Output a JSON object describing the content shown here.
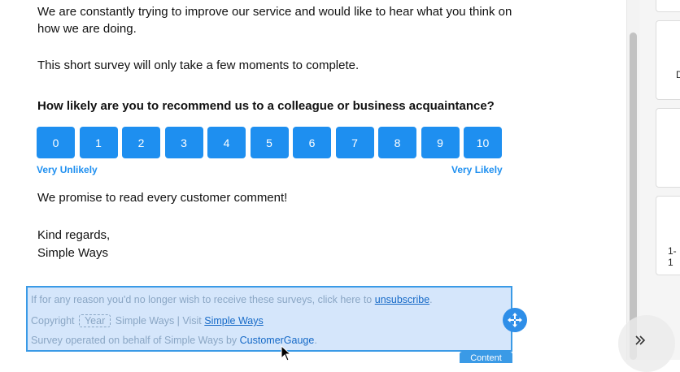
{
  "survey": {
    "intro_line1": "We are constantly trying to improve our service and would like to hear what you think on",
    "intro_line2": "how we are doing.",
    "short_survey": "This short survey will only take a few moments to complete.",
    "question": "How likely are you to recommend us to a colleague or business acquaintance?",
    "scale": [
      "0",
      "1",
      "2",
      "3",
      "4",
      "5",
      "6",
      "7",
      "8",
      "9",
      "10"
    ],
    "label_low": "Very Unlikely",
    "label_high": "Very Likely",
    "promise": "We promise to read every customer comment!",
    "closing": "Kind regards,",
    "signature": "Simple Ways"
  },
  "footer": {
    "unsubscribe_prefix": "If for any reason you'd no longer wish to receive these surveys, click here to ",
    "unsubscribe_link": "unsubscribe",
    "unsubscribe_suffix": ".",
    "copyright_prefix": "Copyright",
    "year_chip": "Year",
    "copyright_mid": "Simple Ways | Visit",
    "visit_link": "Simple Ways",
    "operated_prefix": "Survey operated on behalf of Simple Ways by ",
    "operated_link": "CustomerGauge",
    "operated_suffix": "."
  },
  "editor": {
    "content_tab": "Content",
    "move_icon": "move-arrows-icon",
    "expand_icon": "double-chevron-right-icon"
  },
  "right_panel": {
    "card_text_1": "D",
    "card_text_2": "1-1"
  },
  "colors": {
    "accent": "#1e8ff0",
    "selection_bg": "#d5e6fb",
    "selection_border": "#3a9ae6"
  }
}
